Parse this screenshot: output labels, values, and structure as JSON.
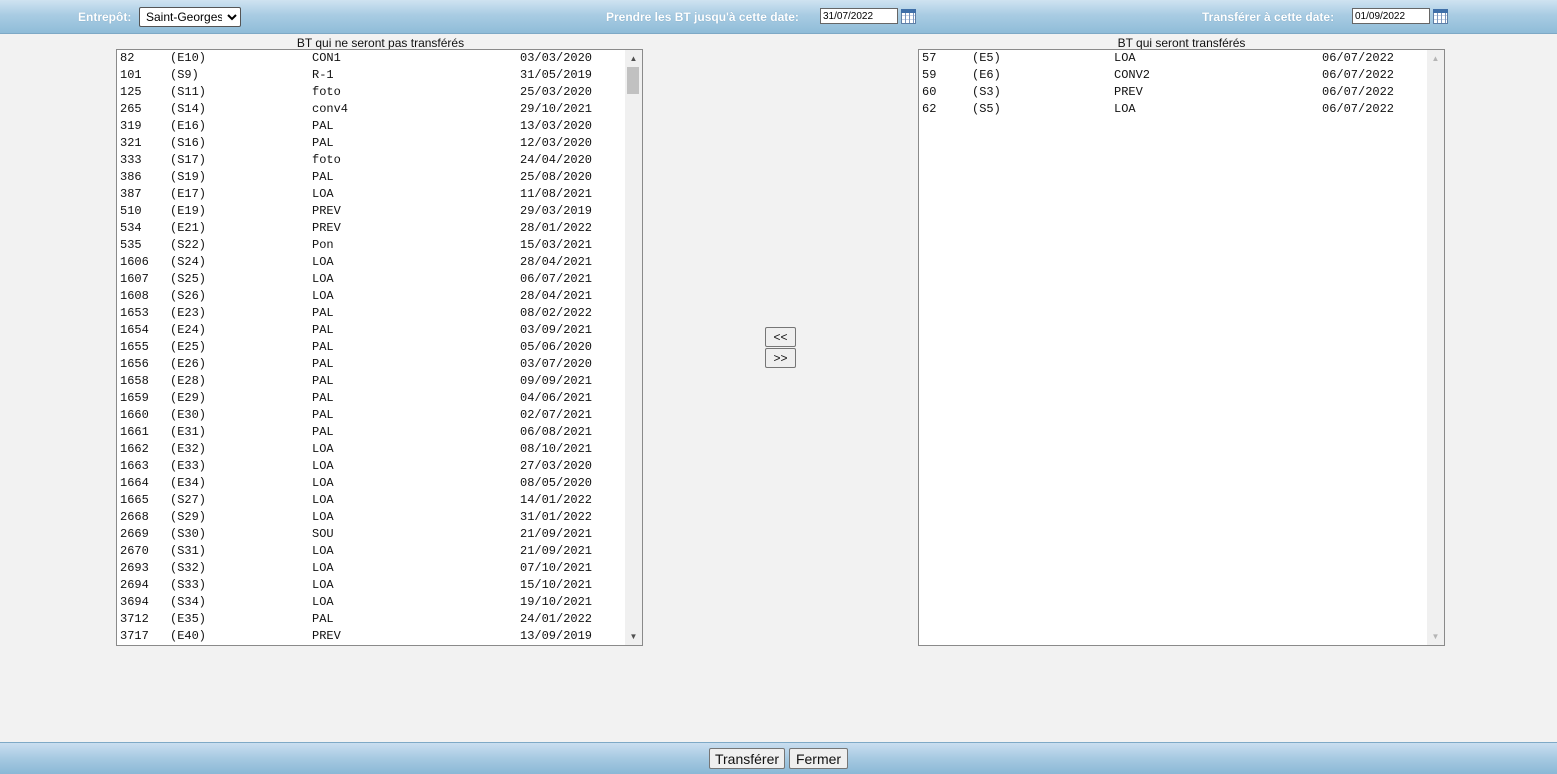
{
  "header": {
    "warehouse_label": "Entrepôt:",
    "warehouse_value": "Saint-Georges",
    "take_until_label": "Prendre les BT jusqu'à cette date:",
    "take_until_value": "31/07/2022",
    "transfer_date_label": "Transférer à cette date:",
    "transfer_date_value": "01/09/2022"
  },
  "left_list": {
    "caption": "BT qui ne seront pas transférés",
    "rows": [
      [
        "82",
        "(E10)",
        "CON1",
        "03/03/2020"
      ],
      [
        "101",
        "(S9)",
        "R-1",
        "31/05/2019"
      ],
      [
        "125",
        "(S11)",
        "foto",
        "25/03/2020"
      ],
      [
        "265",
        "(S14)",
        "conv4",
        "29/10/2021"
      ],
      [
        "319",
        "(E16)",
        "PAL",
        "13/03/2020"
      ],
      [
        "321",
        "(S16)",
        "PAL",
        "12/03/2020"
      ],
      [
        "333",
        "(S17)",
        "foto",
        "24/04/2020"
      ],
      [
        "386",
        "(S19)",
        "PAL",
        "25/08/2020"
      ],
      [
        "387",
        "(E17)",
        "LOA",
        "11/08/2021"
      ],
      [
        "510",
        "(E19)",
        "PREV",
        "29/03/2019"
      ],
      [
        "534",
        "(E21)",
        "PREV",
        "28/01/2022"
      ],
      [
        "535",
        "(S22)",
        "Pon",
        "15/03/2021"
      ],
      [
        "1606",
        "(S24)",
        "LOA",
        "28/04/2021"
      ],
      [
        "1607",
        "(S25)",
        "LOA",
        "06/07/2021"
      ],
      [
        "1608",
        "(S26)",
        "LOA",
        "28/04/2021"
      ],
      [
        "1653",
        "(E23)",
        "PAL",
        "08/02/2022"
      ],
      [
        "1654",
        "(E24)",
        "PAL",
        "03/09/2021"
      ],
      [
        "1655",
        "(E25)",
        "PAL",
        "05/06/2020"
      ],
      [
        "1656",
        "(E26)",
        "PAL",
        "03/07/2020"
      ],
      [
        "1658",
        "(E28)",
        "PAL",
        "09/09/2021"
      ],
      [
        "1659",
        "(E29)",
        "PAL",
        "04/06/2021"
      ],
      [
        "1660",
        "(E30)",
        "PAL",
        "02/07/2021"
      ],
      [
        "1661",
        "(E31)",
        "PAL",
        "06/08/2021"
      ],
      [
        "1662",
        "(E32)",
        "LOA",
        "08/10/2021"
      ],
      [
        "1663",
        "(E33)",
        "LOA",
        "27/03/2020"
      ],
      [
        "1664",
        "(E34)",
        "LOA",
        "08/05/2020"
      ],
      [
        "1665",
        "(S27)",
        "LOA",
        "14/01/2022"
      ],
      [
        "2668",
        "(S29)",
        "LOA",
        "31/01/2022"
      ],
      [
        "2669",
        "(S30)",
        "SOU",
        "21/09/2021"
      ],
      [
        "2670",
        "(S31)",
        "LOA",
        "21/09/2021"
      ],
      [
        "2693",
        "(S32)",
        "LOA",
        "07/10/2021"
      ],
      [
        "2694",
        "(S33)",
        "LOA",
        "15/10/2021"
      ],
      [
        "3694",
        "(S34)",
        "LOA",
        "19/10/2021"
      ],
      [
        "3712",
        "(E35)",
        "PAL",
        "24/01/2022"
      ],
      [
        "3717",
        "(E40)",
        "PREV",
        "13/09/2019"
      ]
    ]
  },
  "right_list": {
    "caption": "BT qui seront transférés",
    "rows": [
      [
        "57",
        "(E5)",
        "LOA",
        "06/07/2022"
      ],
      [
        "59",
        "(E6)",
        "CONV2",
        "06/07/2022"
      ],
      [
        "60",
        "(S3)",
        "PREV",
        "06/07/2022"
      ],
      [
        "62",
        "(S5)",
        "LOA",
        "06/07/2022"
      ]
    ]
  },
  "move_buttons": {
    "left_label": "<<",
    "right_label": ">>"
  },
  "footer": {
    "transfer_label": "Transférer",
    "close_label": "Fermer"
  },
  "icons": {
    "calendar": "calendar-icon",
    "scroll_up": "scroll-up-arrow-icon",
    "scroll_down": "scroll-down-arrow-icon"
  },
  "colors": {
    "bar_top": "#cfe3f1",
    "bar_bottom": "#8fbcd8",
    "background": "#f2f2f2"
  }
}
